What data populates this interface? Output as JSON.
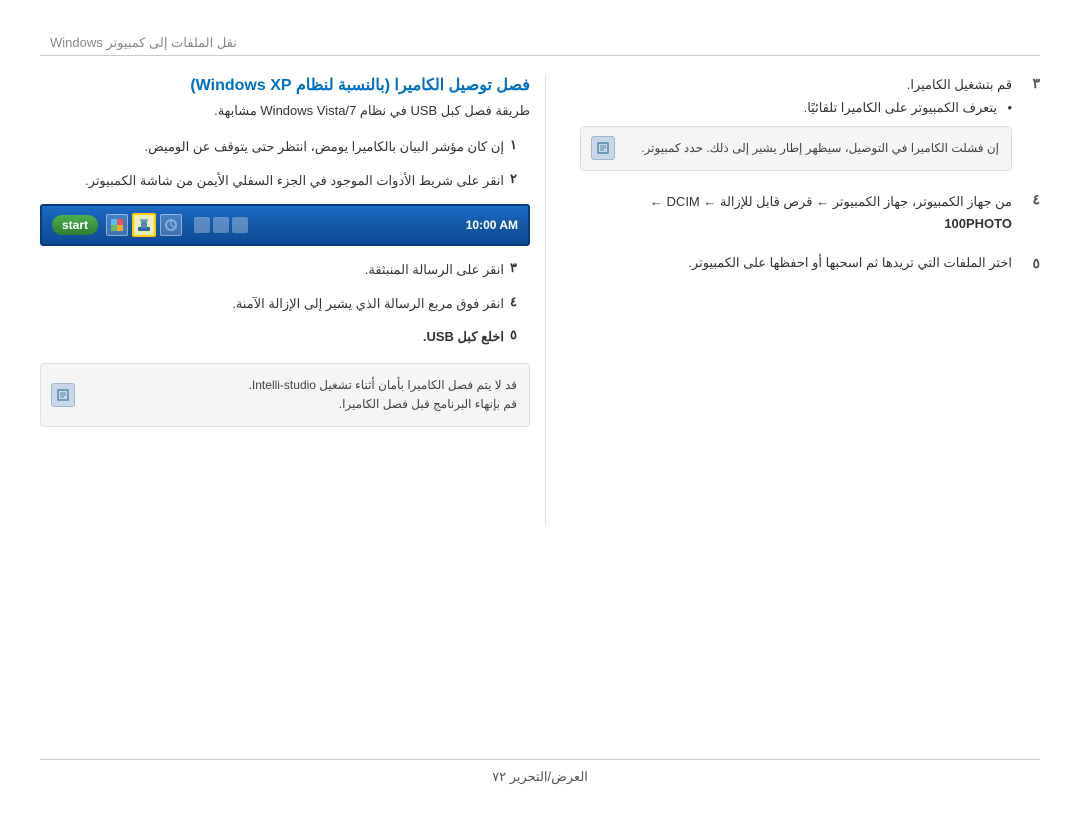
{
  "header": {
    "title": "نقل الملفات إلى كمبيوتر Windows"
  },
  "left_column": {
    "section_title": "فصل توصيل الكاميرا (بالنسبة لنظام Windows XP)",
    "section_subtitle": "طريقة فصل كبل USB في نظام Windows Vista/7 مشابهة.",
    "steps": [
      {
        "number": "١",
        "text": "إن كان مؤشر البيان بالكاميرا يومض، انتظر حتى يتوقف عن الوميض."
      },
      {
        "number": "٢",
        "text": "انقر على شريط الأدوات الموجود في الجزء السفلي الأيمن من شاشة الكمبيوتر."
      },
      {
        "number": "٣",
        "text": "انقر على الرسالة المنبثقة."
      },
      {
        "number": "٤",
        "text": "انقر فوق مربع الرسالة الذي يشير إلى الإزالة الآمنة."
      },
      {
        "number": "٥",
        "text": "اخلع كبل USB."
      }
    ],
    "taskbar_time": "10:00 AM",
    "note": {
      "line1": "قد لا يتم فصل الكاميرا بأمان أثناء تشغيل Intelli-studio.",
      "line2": "قم بإنهاء البرنامج قبل فصل الكاميرا."
    }
  },
  "right_column": {
    "steps": [
      {
        "number": "٣",
        "text": "قم بتشغيل الكاميرا.",
        "bullet": "يتعرف الكمبيوتر على الكاميرا تلقائيًا.",
        "note": "إن فشلت الكاميرا في التوصيل، سيظهر إطار يشير إلى ذلك. حدد كمبيوتر."
      },
      {
        "number": "٤",
        "text_line1": "من جهاز الكمبيوتر، جهاز الكمبيوتر ← قرص قابل للإزالة ← DCIM ←",
        "text_line2": "100PHOTO"
      },
      {
        "number": "٥",
        "text": "اختر الملفات التي تريدها ثم اسحبها أو احفظها على الكمبيوتر."
      }
    ]
  },
  "footer": {
    "text": "العرض/التحرير  ٧٢"
  },
  "icons": {
    "note_icon": "✎",
    "taskbar_icon": "⊞"
  }
}
